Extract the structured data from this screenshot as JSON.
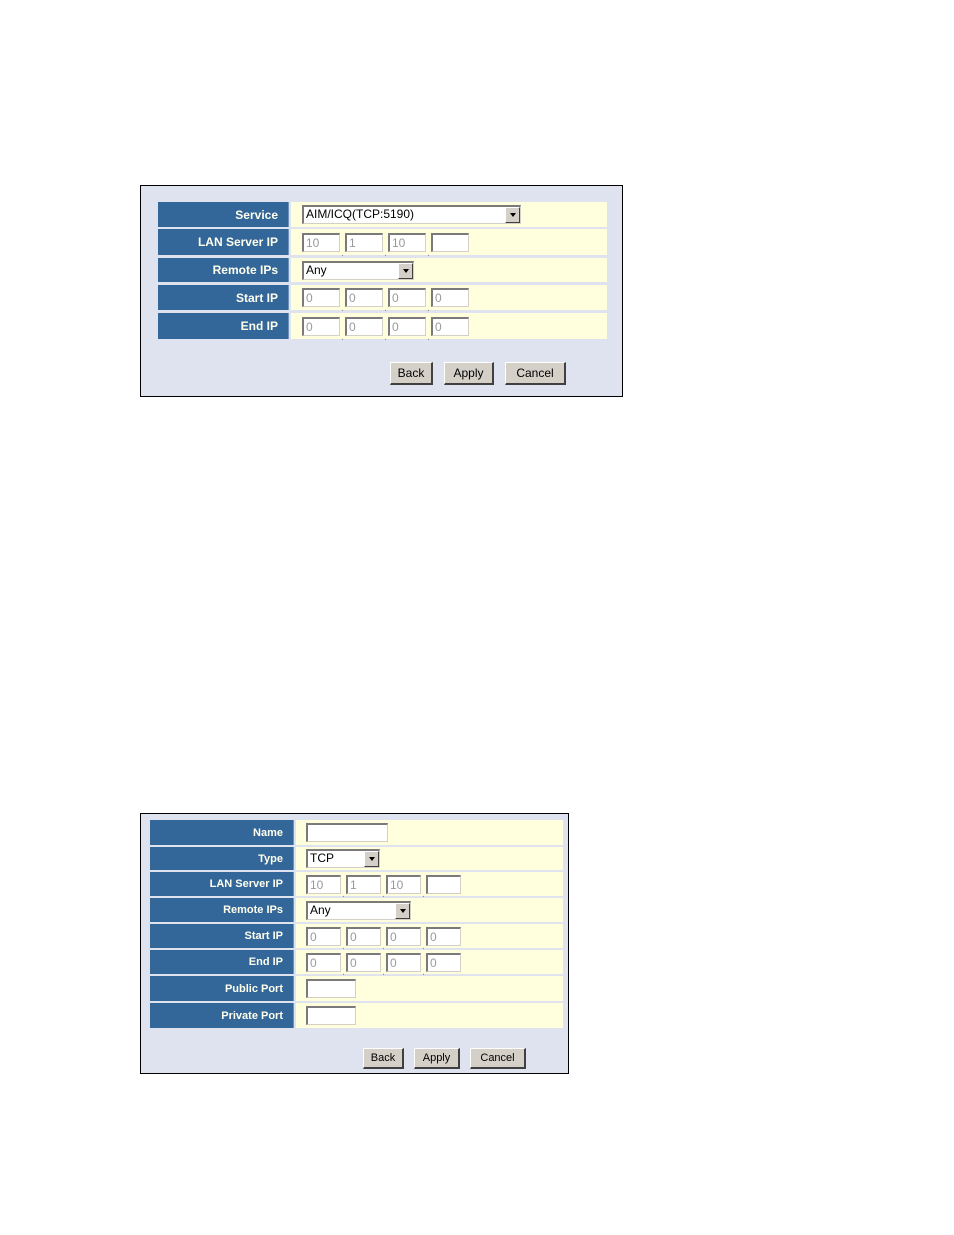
{
  "form1": {
    "rows": [
      {
        "label": "Service",
        "type": "select",
        "value": "AIM/ICQ(TCP:5190)"
      },
      {
        "label": "LAN Server IP",
        "type": "ip",
        "octets": [
          "10",
          "1",
          "10",
          ""
        ]
      },
      {
        "label": "Remote IPs",
        "type": "select",
        "value": "Any"
      },
      {
        "label": "Start IP",
        "type": "ip",
        "octets": [
          "0",
          "0",
          "0",
          "0"
        ]
      },
      {
        "label": "End IP",
        "type": "ip",
        "octets": [
          "0",
          "0",
          "0",
          "0"
        ]
      }
    ],
    "buttons": {
      "back": "Back",
      "apply": "Apply",
      "cancel": "Cancel"
    }
  },
  "form2": {
    "rows": [
      {
        "label": "Name",
        "type": "text",
        "value": ""
      },
      {
        "label": "Type",
        "type": "select",
        "value": "TCP"
      },
      {
        "label": "LAN Server IP",
        "type": "ip",
        "octets": [
          "10",
          "1",
          "10",
          ""
        ]
      },
      {
        "label": "Remote IPs",
        "type": "select",
        "value": "Any"
      },
      {
        "label": "Start IP",
        "type": "ip",
        "octets": [
          "0",
          "0",
          "0",
          "0"
        ]
      },
      {
        "label": "End IP",
        "type": "ip",
        "octets": [
          "0",
          "0",
          "0",
          "0"
        ]
      },
      {
        "label": "Public Port",
        "type": "text",
        "value": ""
      },
      {
        "label": "Private Port",
        "type": "text",
        "value": ""
      }
    ],
    "buttons": {
      "back": "Back",
      "apply": "Apply",
      "cancel": "Cancel"
    }
  },
  "colors": {
    "label_bg": "#336699",
    "label_text": "#ffffee",
    "value_bg": "#ffffdd",
    "panel_bg": "#dfe3ef"
  }
}
